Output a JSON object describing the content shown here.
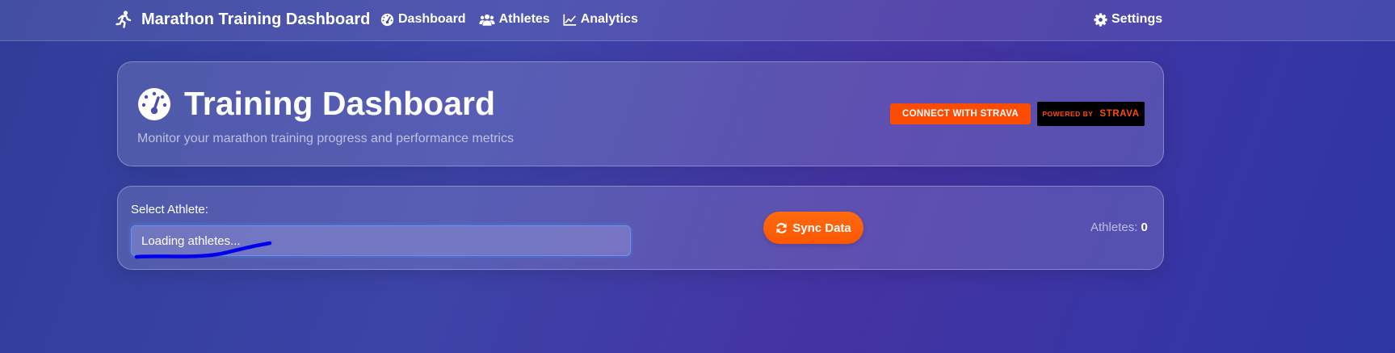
{
  "navbar": {
    "brand_icon": "running-person-icon",
    "brand_title": "Marathon Training Dashboard",
    "links": [
      {
        "label": "Dashboard",
        "icon": "gauge-icon"
      },
      {
        "label": "Athletes",
        "icon": "users-icon"
      },
      {
        "label": "Analytics",
        "icon": "line-chart-icon"
      }
    ],
    "settings": {
      "label": "Settings",
      "icon": "gear-icon"
    }
  },
  "header": {
    "icon": "speedometer-icon",
    "title": "Training Dashboard",
    "subtitle": "Monitor your marathon training progress and performance metrics",
    "strava_connect_label": "CONNECT WITH STRAVA",
    "strava_powered_prefix": "POWERED BY",
    "strava_powered_brand": "STRAVA"
  },
  "athlete_panel": {
    "select_label": "Select Athlete:",
    "select_value": "Loading athletes...",
    "sync_label": "Sync Data",
    "count_label": "Athletes:",
    "count_value": "0"
  },
  "colors": {
    "strava_orange": "#fc4c02",
    "sync_orange": "#fb5700",
    "annotation_blue": "#0000ee"
  }
}
